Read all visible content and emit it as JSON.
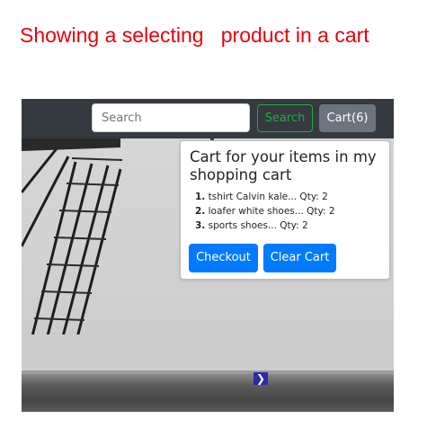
{
  "caption": "Showing a selecting   product in a cart",
  "navbar": {
    "search_placeholder": "Search",
    "search_button": "Search",
    "cart_button": "Cart(6)",
    "colors": {
      "navbar": "#343a40",
      "search": "#28a745",
      "cart": "#6c757d"
    }
  },
  "cart_popover": {
    "title": "Cart for your items in my shopping cart",
    "items": [
      {
        "num": "1.",
        "text": "tshirt Calvin kale... Qty: 2"
      },
      {
        "num": "2.",
        "text": "loafer white shoes... Qty: 2"
      },
      {
        "num": "3.",
        "text": "sports shoes... Qty: 2"
      }
    ],
    "checkout_label": "Checkout",
    "clear_label": "Clear Cart",
    "button_color": "#007bff"
  },
  "carousel": {
    "next_icon": "chevron-right-icon",
    "next_glyph": "❯"
  }
}
